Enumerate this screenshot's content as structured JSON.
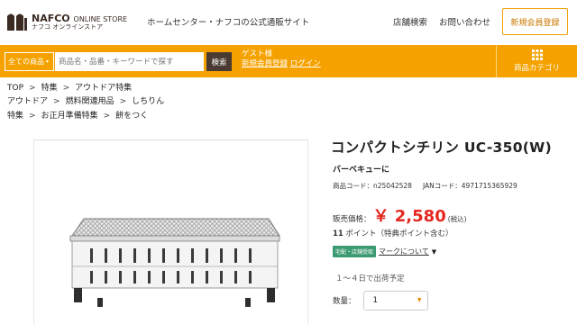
{
  "header": {
    "logo_main": "NAFCO",
    "logo_main_suffix": "ONLINE STORE",
    "logo_sub": "ナフコ オンラインストア",
    "tagline": "ホームセンター・ナフコの公式通販サイト",
    "store_search": "店舗検索",
    "contact": "お問い合わせ",
    "register": "新規会員登録"
  },
  "search": {
    "category": "全ての商品",
    "placeholder": "商品名・品番・キーワードで探す",
    "button": "検索"
  },
  "guest": {
    "name": "ゲスト様",
    "register_link": "新規会員登録",
    "login_link": "ログイン"
  },
  "category_menu": {
    "label": "商品カテゴリ"
  },
  "breadcrumbs": [
    [
      "TOP",
      "特集",
      "アウトドア特集"
    ],
    [
      "アウトドア",
      "燃料関連用品",
      "しちりん"
    ],
    [
      "特集",
      "お正月準備特集",
      "餅をつく"
    ]
  ],
  "product": {
    "title": "コンパクトシチリン UC-350(W)",
    "subtitle": "バーベキューに",
    "code": "商品コード：n25042528",
    "jan": "JANコード：4971715365929",
    "price_label": "販売価格：",
    "price": "￥ 2,580",
    "tax": "(税込)",
    "points_num": "11",
    "points_text": " ポイント（特典ポイント含む）",
    "badge": "宅配・店舗受取",
    "mark_link": "マークについて",
    "ship": "１～４日で出荷予定",
    "qty_label": "数量：",
    "qty_value": "1"
  },
  "colors": {
    "accent": "#f5a200",
    "brand_dark": "#4a3b32",
    "price": "#e4271f",
    "badge": "#3d9b72"
  }
}
